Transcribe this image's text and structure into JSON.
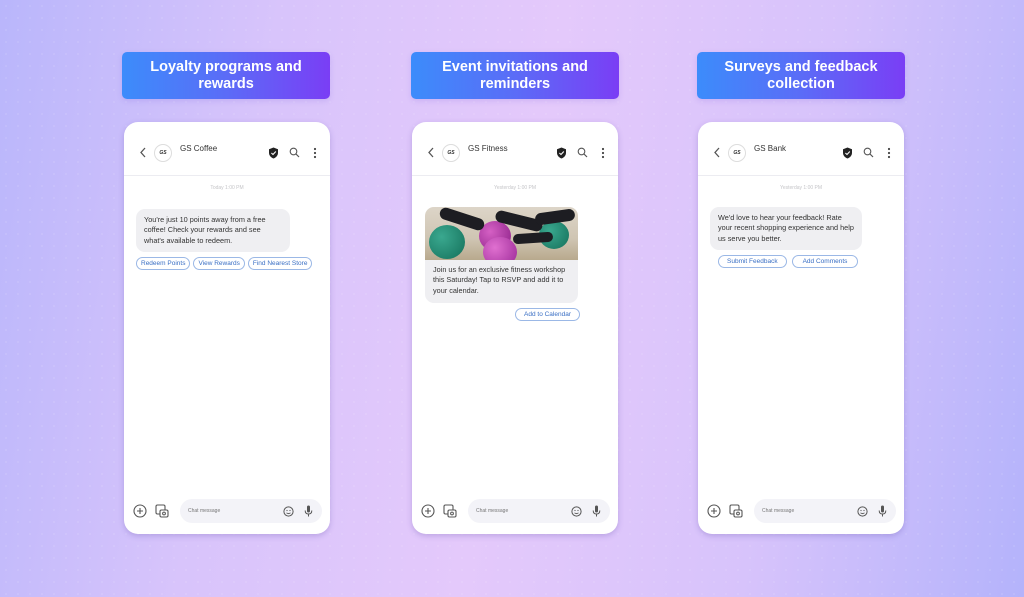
{
  "colors": {
    "badge_gradient_start": "#3c8cfb",
    "badge_gradient_end": "#7a3ef5",
    "chip_text": "#3a6fc4",
    "chip_border": "#9bb8e6",
    "bubble_bg": "#efeff2"
  },
  "panels": [
    {
      "title": "Loyalty programs and rewards",
      "chat": {
        "brand_name": "GS Coffee",
        "logo_text": "GS",
        "timestamp": "Today 1:00 PM",
        "message": "You're just 10 points away from a free coffee! Check your rewards and see what's available to redeem.",
        "chips": [
          "Redeem Points",
          "View Rewards",
          "Find Nearest Store"
        ],
        "composer_placeholder": "Chat message"
      }
    },
    {
      "title": "Event invitations and reminders",
      "chat": {
        "brand_name": "GS Fitness",
        "logo_text": "GS",
        "timestamp": "Yesterday 1:00 PM",
        "image_alt": "Group fitness class with exercise balls",
        "message": "Join us for an exclusive fitness workshop this Saturday! Tap to RSVP and add it to your calendar.",
        "chips": [
          "Add to Calendar"
        ],
        "composer_placeholder": "Chat message"
      }
    },
    {
      "title": "Surveys and feedback collection",
      "chat": {
        "brand_name": "GS Bank",
        "logo_text": "GS",
        "timestamp": "Yesterday 1:00 PM",
        "message": "We'd love to hear your feedback! Rate your recent shopping experience and help us serve you better.",
        "chips": [
          "Submit Feedback",
          "Add Comments"
        ],
        "composer_placeholder": "Chat message"
      }
    }
  ],
  "icons": {
    "back": "chevron-left",
    "verified": "verified-shield",
    "search": "magnifier",
    "more": "vertical-dots",
    "add": "plus-circle",
    "media": "gallery",
    "emoji": "smiley",
    "mic": "microphone"
  }
}
